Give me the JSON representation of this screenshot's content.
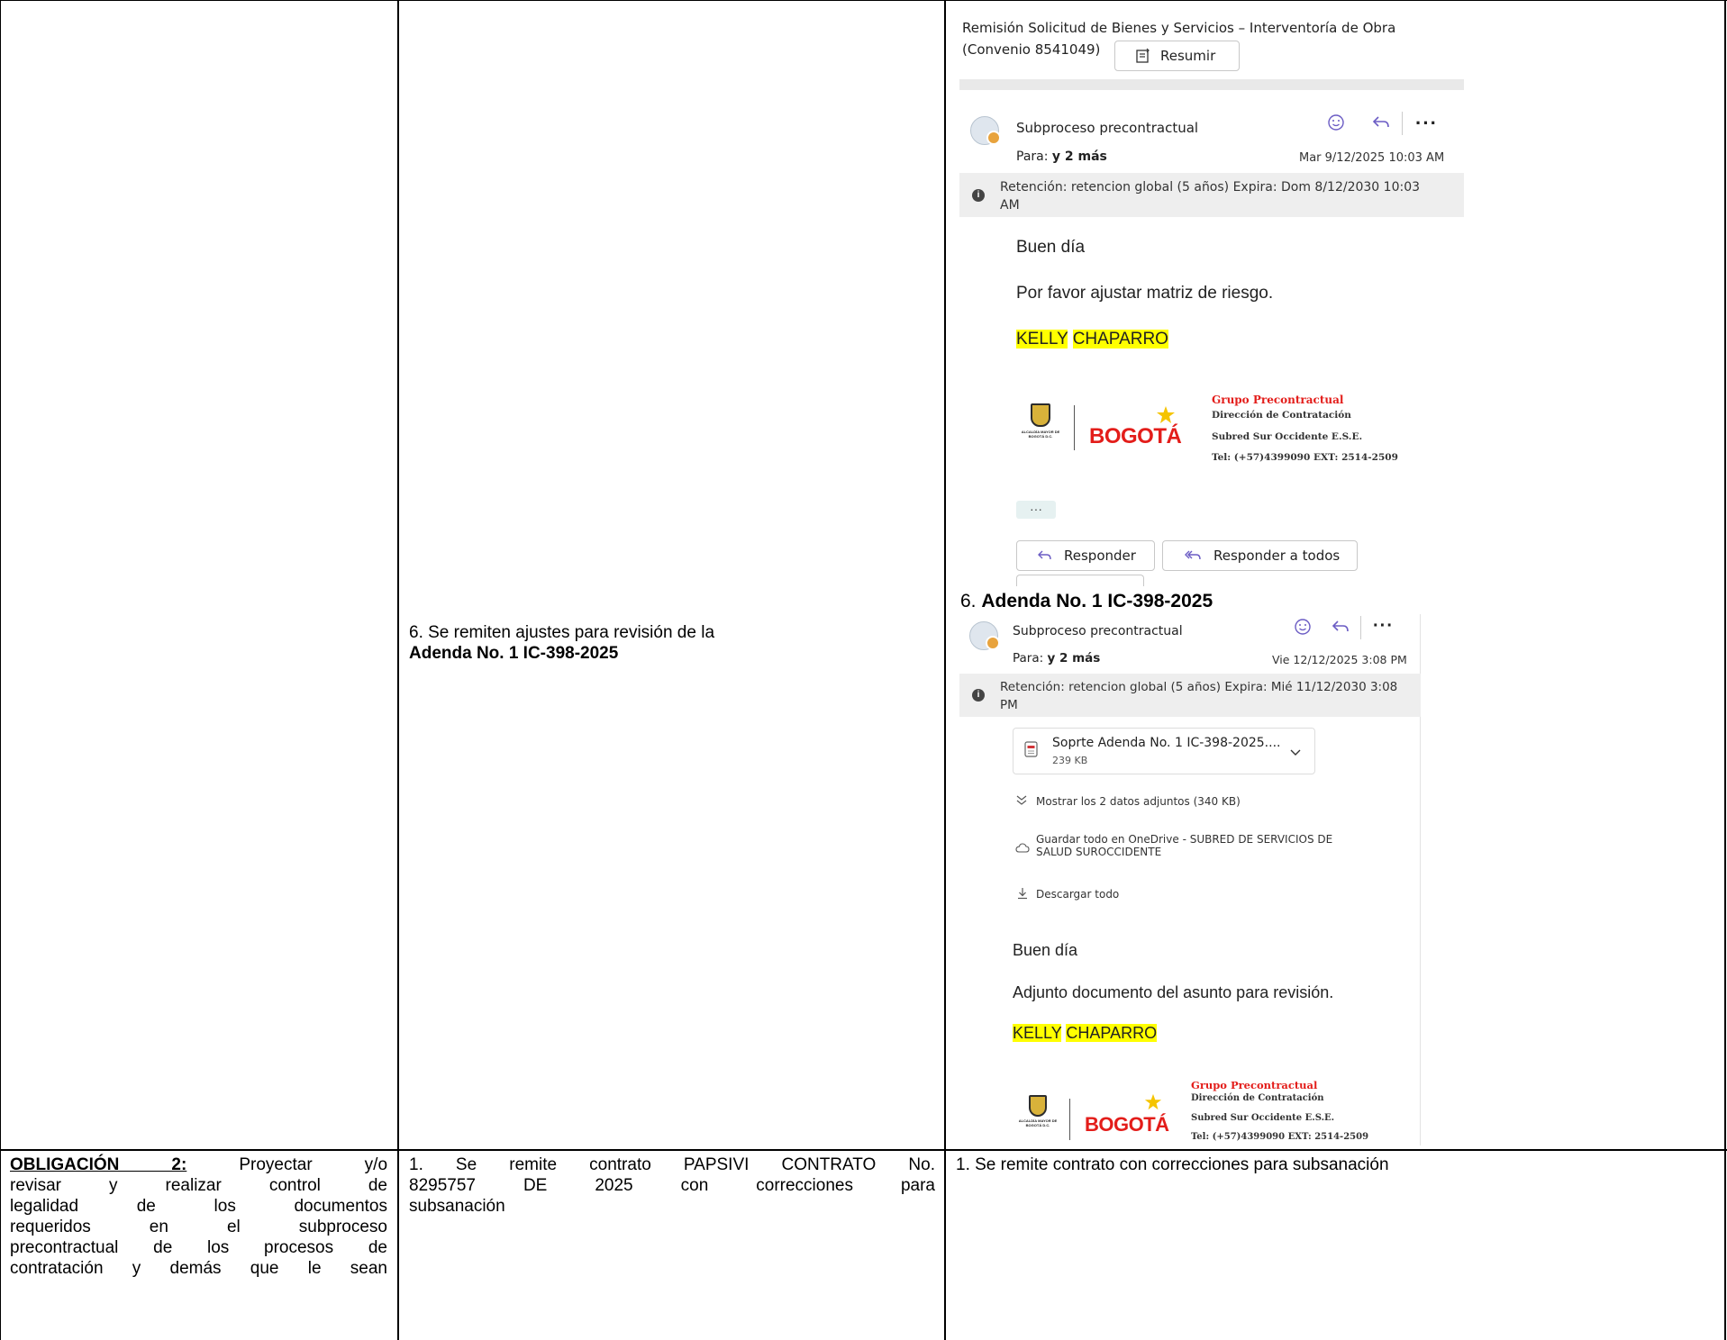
{
  "row1": {
    "col2_text_prefix": "6. Se remiten ajustes para revisión de la",
    "col2_text_bold": "Adenda No. 1 IC-398-2025"
  },
  "email1": {
    "subject_line1": "Remisión Solicitud de Bienes y Servicios – Interventoría de Obra",
    "subject_line2": "(Convenio 8541049)",
    "summarize_label": "Resumir",
    "sender": "Subproceso precontractual",
    "to_label": "Para:",
    "to_value": "y 2 más",
    "date": "Mar 9/12/2025 10:03 AM",
    "retention_line1": "Retención: retencion global (5 años) Expira: Dom 8/12/2030 10:03",
    "retention_line2": "AM",
    "greeting": "Buen día",
    "body": "Por favor ajustar matriz de riesgo.",
    "signature_first": "KELLY",
    "signature_last": "CHAPARRO",
    "more": "···",
    "reply_label": "Responder",
    "reply_all_label": "Responder a todos"
  },
  "sig": {
    "group": "Grupo Precontractual",
    "dept": "Dirección de Contratación",
    "org": "Subred Sur Occidente E.S.E.",
    "tel": "Tel: (+57)4399090  EXT: 2514-2509",
    "brand": "BOGOTÁ",
    "seal_text": "ALCALDÍA MAYOR DE BOGOTÁ D.C."
  },
  "email2": {
    "heading_prefix": "6.",
    "heading_bold": "Adenda No. 1 IC-398-2025",
    "sender": "Subproceso precontractual",
    "to_label": "Para:",
    "to_value": "y 2 más",
    "date": "Vie 12/12/2025 3:08 PM",
    "retention_line1": "Retención: retencion global (5 años) Expira: Mié 11/12/2030 3:08",
    "retention_line2": "PM",
    "attachment_name": "Soprte Adenda No. 1 IC-398-2025....",
    "attachment_size": "239 KB",
    "show_attachments": "Mostrar los 2 datos adjuntos (340 KB)",
    "save_onedrive_line1": "Guardar todo en OneDrive - SUBRED DE SERVICIOS DE",
    "save_onedrive_line2": "SALUD SUROCCIDENTE",
    "download_all": "Descargar todo",
    "greeting": "Buen día",
    "body": "Adjunto documento del asunto para revisión.",
    "signature_first": "KELLY",
    "signature_last": "CHAPARRO"
  },
  "row2": {
    "col1_bold": "OBLIGACIÓN 2:",
    "col1_lines": [
      "Proyectar y/o",
      "revisar y realizar control de",
      "legalidad de los documentos",
      "requeridos en el subproceso",
      "precontractual de los procesos de",
      "contratación y demás que le sean"
    ],
    "col2_lines": [
      "1. Se remite contrato PAPSIVI CONTRATO No.",
      "8295757 DE 2025 con correcciones para",
      "subsanación"
    ],
    "col3_text": "1. Se remite contrato con correcciones para subsanación"
  },
  "icons": [
    "emoji-icon",
    "reply-icon",
    "more-icon",
    "info-icon",
    "summarize-icon",
    "attachment-icon",
    "chevron-down-icon",
    "double-chevron-icon",
    "cloud-icon",
    "download-icon"
  ]
}
